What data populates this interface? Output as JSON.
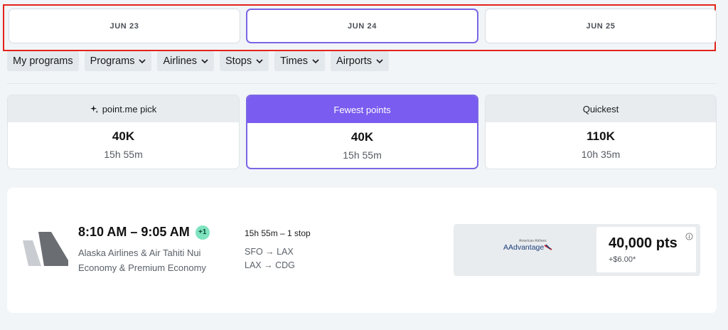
{
  "dates": [
    {
      "label": "JUN 23",
      "selected": false
    },
    {
      "label": "JUN 24",
      "selected": true
    },
    {
      "label": "JUN 25",
      "selected": false
    }
  ],
  "filters": {
    "my_programs": "My programs",
    "programs": "Programs",
    "airlines": "Airlines",
    "stops": "Stops",
    "times": "Times",
    "airports": "Airports",
    "chevron_icon": "chevron-down-icon"
  },
  "sort_options": [
    {
      "label": "point.me pick",
      "icon": "sparkle-icon",
      "points": "40K",
      "duration": "15h 55m",
      "selected": false
    },
    {
      "label": "Fewest points",
      "points": "40K",
      "duration": "15h 55m",
      "selected": true
    },
    {
      "label": "Quickest",
      "points": "110K",
      "duration": "10h 35m",
      "selected": false
    }
  ],
  "flight": {
    "times": "8:10 AM – 9:05 AM",
    "day_offset": "+1",
    "airlines": "Alaska Airlines & Air Tahiti Nui",
    "cabin": "Economy & Premium Economy",
    "duration_stops": "15h 55m – 1 stop",
    "segments": [
      "SFO → LAX",
      "LAX → CDG"
    ],
    "offer": {
      "program_small": "American Airlines",
      "program": "AAdvantage",
      "points": "40,000 pts",
      "fee": "+$6.00*"
    }
  },
  "colors": {
    "accent": "#7a5cf0",
    "highlight_outline": "#e2231a",
    "day_badge": "#7fe3c0"
  }
}
